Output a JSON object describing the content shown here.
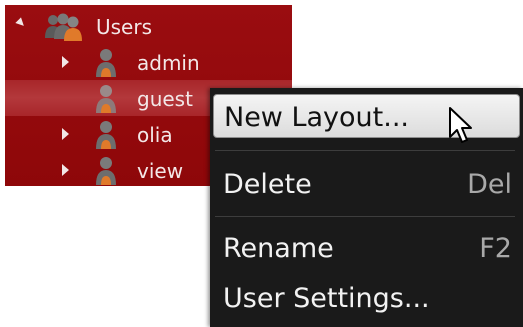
{
  "tree": {
    "root": {
      "label": "Users",
      "expanded": true
    },
    "children": [
      {
        "label": "admin",
        "has_children": true
      },
      {
        "label": "guest",
        "has_children": false,
        "selected": true
      },
      {
        "label": "olia",
        "has_children": true
      },
      {
        "label": "view",
        "has_children": true
      }
    ]
  },
  "context_menu": {
    "items": [
      {
        "label": "New Layout...",
        "shortcut": "",
        "highlighted": true
      },
      {
        "label": "Delete",
        "shortcut": "Del"
      },
      {
        "label": "Rename",
        "shortcut": "F2"
      },
      {
        "label": "User Settings...",
        "shortcut": ""
      }
    ]
  },
  "colors": {
    "tree_background": "#930a0d",
    "selected_row": "#b3383b",
    "menu_background": "#1a1a1a",
    "menu_highlight": "#e8e8e8",
    "shortcut_text": "#a9a9a9",
    "user_icon": "#e07a2a"
  },
  "icons": {
    "root": "users-group-icon",
    "child": "user-icon",
    "cursor": "mouse-pointer-icon"
  }
}
